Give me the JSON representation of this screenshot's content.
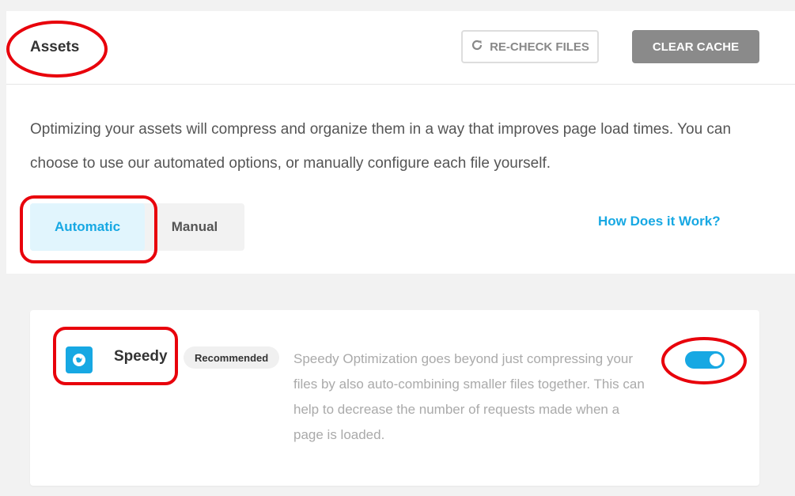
{
  "header": {
    "title": "Assets",
    "recheck_label": "RE-CHECK FILES",
    "clear_label": "CLEAR CACHE"
  },
  "description": "Optimizing your assets will compress and organize them in a way that improves page load times. You can choose to use our automated options, or manually configure each file yourself.",
  "tabs": [
    {
      "label": "Automatic",
      "active": true
    },
    {
      "label": "Manual",
      "active": false
    }
  ],
  "help_link": "How Does it Work?",
  "option": {
    "name": "Speedy",
    "badge": "Recommended",
    "description": "Speedy Optimization goes beyond just compressing your files by also auto-combining smaller files together. This can help to decrease the number of requests made when a page is loaded.",
    "enabled": true,
    "icon": "speedy-bird-icon"
  },
  "colors": {
    "accent": "#17a8e3",
    "annotation": "#e8000b",
    "clear_button": "#8a8a8a",
    "page_bg": "#f2f2f2"
  }
}
